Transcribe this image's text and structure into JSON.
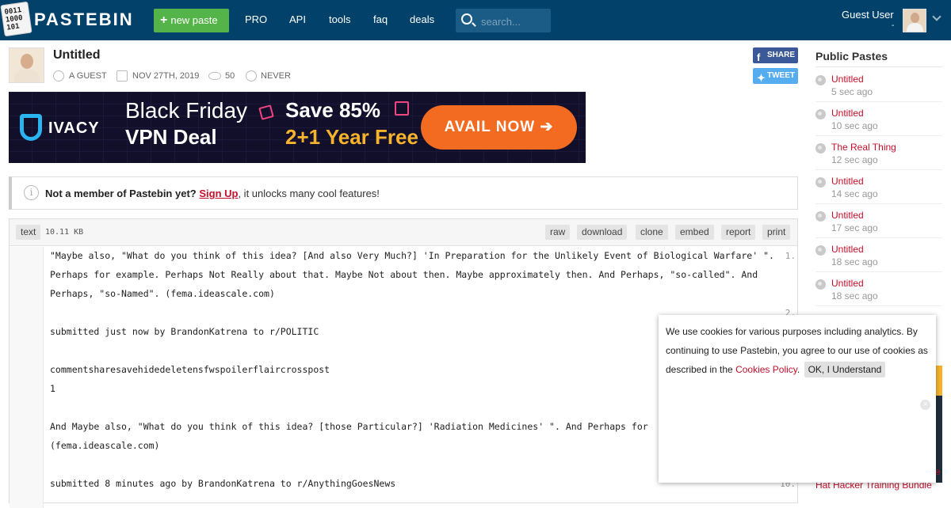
{
  "header": {
    "logo_text": "PASTEBIN",
    "logo_icon_text": [
      "0011",
      "1000",
      "101"
    ],
    "new_paste_label": "new paste",
    "nav": [
      "PRO",
      "API",
      "tools",
      "faq",
      "deals"
    ],
    "search_placeholder": "search...",
    "user_name": "Guest User",
    "user_dash": "-"
  },
  "paste": {
    "title": "Untitled",
    "author": "A GUEST",
    "date": "NOV 27TH, 2019",
    "views": "50",
    "expires": "NEVER",
    "share_label": "SHARE",
    "tweet_label": "TWEET"
  },
  "banner": {
    "brand": "IVACY",
    "line1": "Black Friday",
    "line2": "VPN Deal",
    "save": "Save 85%",
    "offer": "2+1 Year Free",
    "cta": "AVAIL NOW ➔"
  },
  "notice": {
    "bold": "Not a member of Pastebin yet?",
    "link": "Sign Up",
    "rest": ", it unlocks many cool features!"
  },
  "code": {
    "syntax": "text",
    "size": "10.11 KB",
    "actions": [
      "raw",
      "download",
      "clone",
      "embed",
      "report",
      "print"
    ],
    "lines": [
      {
        "n": "1.",
        "text": "\"Maybe also, \"What do you think of this idea? [And also Very Much?] 'In Preparation for the Unlikely Event of Biological Warfare' \". Perhaps for example. Perhaps Not Really about that. Maybe Not about then. Maybe approximately then. And Perhaps, \"so-called\". And Perhaps, \"so-Named\". (fema.ideascale.com)"
      },
      {
        "n": "2.",
        "text": ""
      },
      {
        "n": "3.",
        "text": "submitted just now by BrandonKatrena to r/POLITIC"
      },
      {
        "n": "4.",
        "text": ""
      },
      {
        "n": "5.",
        "text": "commentsharesavehidedeletensfwspoilerflaircrosspost"
      },
      {
        "n": "6.",
        "text": "1"
      },
      {
        "n": "7.",
        "text": ""
      },
      {
        "n": "8.",
        "text": "And Maybe also, \"What do you think of this idea? [those Particular?] 'Radiation Medicines' \". And Perhaps for"
      },
      {
        "n": "9.",
        "text": ""
      },
      {
        "n": "10.",
        "text": "submitted 8 minutes ago by BrandonKatrena to r/AnythingGoesNews"
      }
    ],
    "line8_cont": "(fema.ideascale.com)"
  },
  "sidebar": {
    "title": "Public Pastes",
    "items": [
      {
        "title": "Untitled",
        "age": "5 sec ago"
      },
      {
        "title": "Untitled",
        "age": "10 sec ago"
      },
      {
        "title": "The Real Thing",
        "age": "12 sec ago"
      },
      {
        "title": "Untitled",
        "age": "14 sec ago"
      },
      {
        "title": "Untitled",
        "age": "17 sec ago"
      },
      {
        "title": "Untitled",
        "age": "18 sec ago"
      },
      {
        "title": "Untitled",
        "age": "18 sec ago"
      }
    ],
    "ad_link_fragment": "S",
    "ad_tail_e": "e",
    "ad_tail_text": "Hat Hacker Training Bundle"
  },
  "cookie": {
    "message": "We use cookies for various purposes including analytics. By continuing to use Pastebin, you agree to our use of cookies as described in the",
    "policy_link": "Cookies Policy",
    "dot": ".",
    "ok_label": "OK, I Understand",
    "close_icon": "×"
  },
  "colors": {
    "header_bg": "#02426a",
    "new_paste_green": "#55b449",
    "link_red": "#c4102a",
    "facebook_blue": "#3b5998",
    "twitter_blue": "#55acee",
    "cta_orange": "#f26b21"
  }
}
